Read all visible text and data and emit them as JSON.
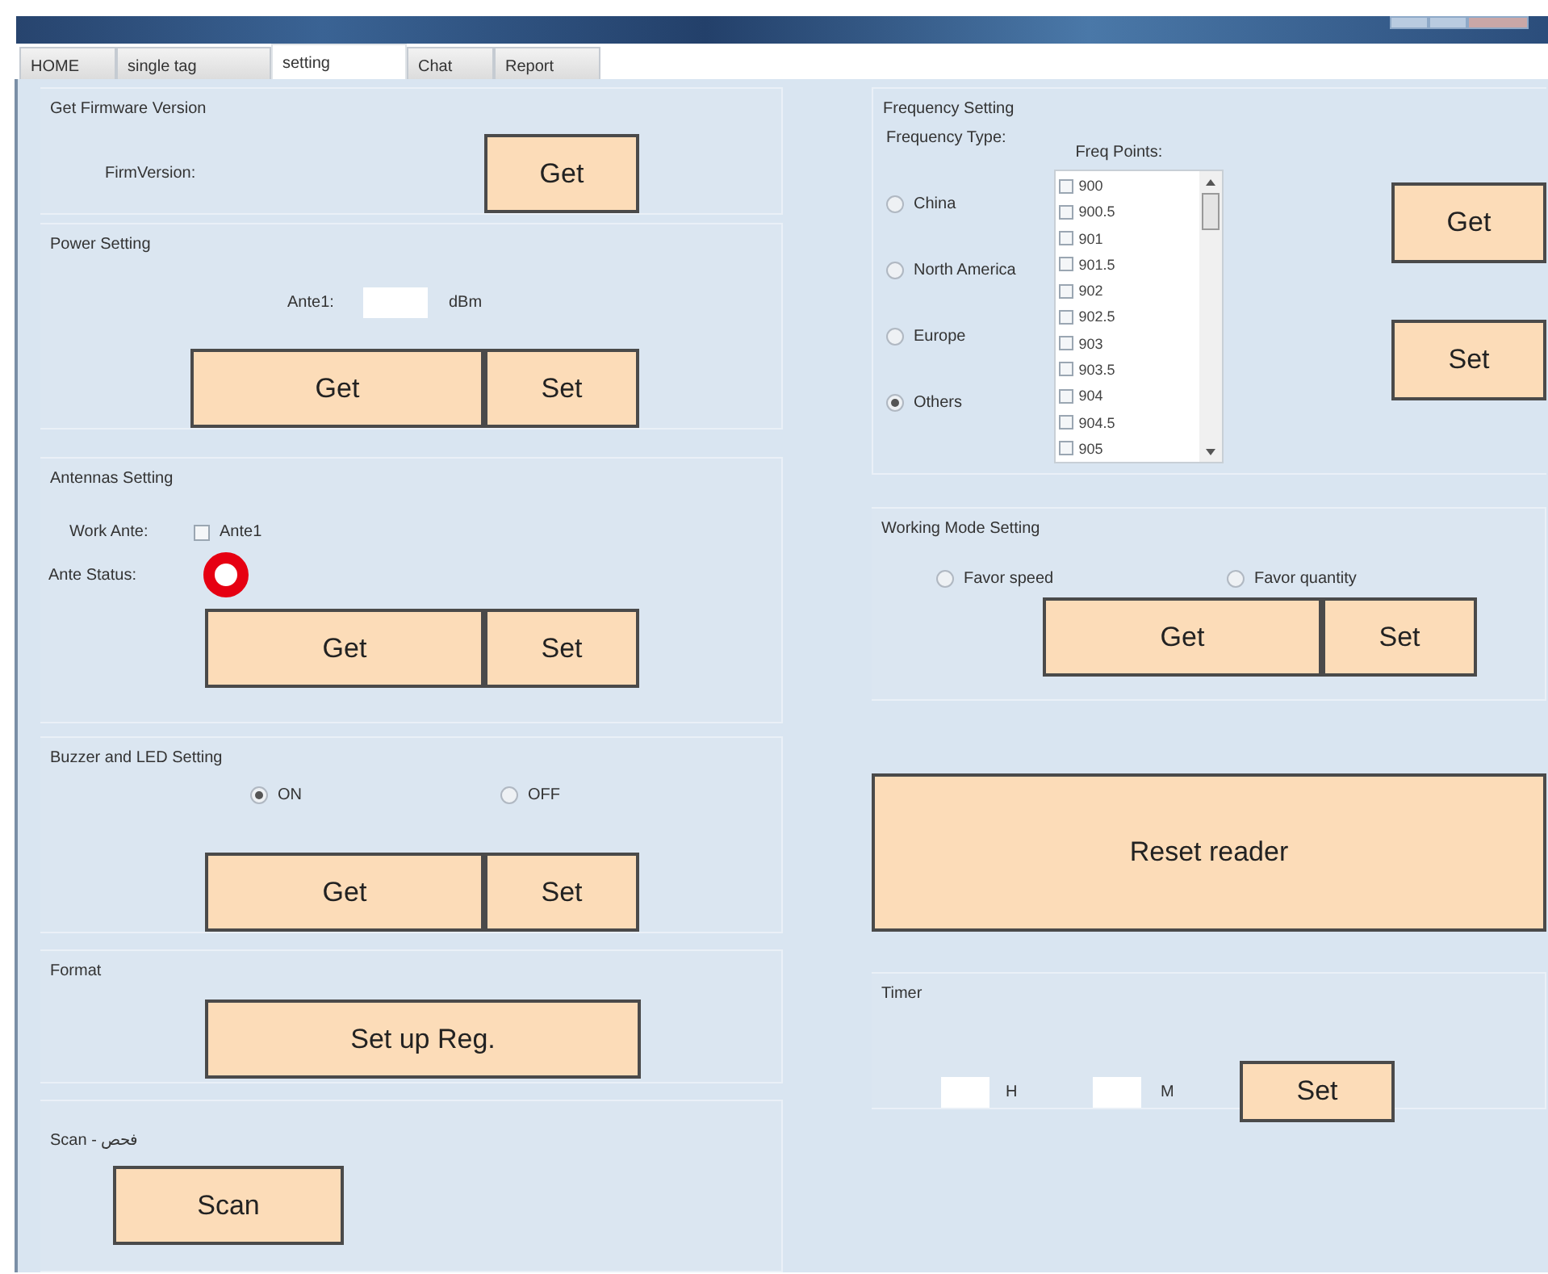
{
  "tabs": [
    {
      "label": "HOME",
      "selected": false
    },
    {
      "label": "single tag",
      "selected": false
    },
    {
      "label": "setting",
      "selected": true
    },
    {
      "label": "Chat",
      "selected": false
    },
    {
      "label": "Report",
      "selected": false
    }
  ],
  "left_column": [
    {
      "kind": "group",
      "title": "Get Firmware Version",
      "rows": [
        {
          "items": [
            {
              "kind": "label",
              "text": "FirmVersion:"
            },
            {
              "kind": "button",
              "text": "Get"
            }
          ]
        }
      ]
    },
    {
      "kind": "group",
      "title": "Power Setting",
      "rows": [
        {
          "items": [
            {
              "kind": "label",
              "text": "Ante1:"
            },
            {
              "kind": "input"
            },
            {
              "kind": "label",
              "text": "dBm"
            }
          ]
        },
        {
          "items": [
            {
              "kind": "button",
              "text": "Get"
            },
            {
              "kind": "button",
              "text": "Set"
            }
          ]
        }
      ]
    },
    {
      "kind": "group",
      "title": "Antennas  Setting",
      "rows": [
        {
          "items": [
            {
              "kind": "label",
              "text": "Work Ante:"
            },
            {
              "kind": "checkbox",
              "text": "Ante1",
              "checked": false
            }
          ]
        },
        {
          "items": [
            {
              "kind": "label",
              "text": "Ante Status:"
            },
            {
              "kind": "status",
              "color": "#e60012"
            }
          ]
        },
        {
          "items": [
            {
              "kind": "button",
              "text": "Get"
            },
            {
              "kind": "button",
              "text": "Set"
            }
          ]
        }
      ]
    },
    {
      "kind": "group",
      "title": "Buzzer and LED Setting",
      "rows": [
        {
          "items": [
            {
              "kind": "radio",
              "text": "ON",
              "selected": true
            },
            {
              "kind": "radio",
              "text": "OFF",
              "selected": false
            }
          ]
        },
        {
          "items": [
            {
              "kind": "button",
              "text": "Get"
            },
            {
              "kind": "button",
              "text": "Set"
            }
          ]
        }
      ]
    },
    {
      "kind": "group",
      "title": "Format",
      "rows": [
        {
          "items": [
            {
              "kind": "button",
              "text": "Set up Reg."
            }
          ]
        }
      ]
    },
    {
      "kind": "group",
      "title": "Scan - فحص",
      "rows": [
        {
          "items": [
            {
              "kind": "button",
              "text": "Scan"
            }
          ]
        }
      ]
    }
  ],
  "right_column": [
    {
      "kind": "frequency",
      "title": "Frequency Setting",
      "type_label": "Frequency Type:",
      "types": [
        {
          "label": "China",
          "selected": false
        },
        {
          "label": "North America",
          "selected": false
        },
        {
          "label": "Europe",
          "selected": false
        },
        {
          "label": "Others",
          "selected": true
        }
      ],
      "points_label": "Freq Points:",
      "points": [
        {
          "label": "900",
          "checked": false
        },
        {
          "label": "900.5",
          "checked": false
        },
        {
          "label": "901",
          "checked": false
        },
        {
          "label": "901.5",
          "checked": false
        },
        {
          "label": "902",
          "checked": false
        },
        {
          "label": "902.5",
          "checked": false
        },
        {
          "label": "903",
          "checked": false
        },
        {
          "label": "903.5",
          "checked": false
        },
        {
          "label": "904",
          "checked": false
        },
        {
          "label": "904.5",
          "checked": false
        },
        {
          "label": "905",
          "checked": false
        }
      ],
      "buttons": [
        "Get",
        "Set"
      ]
    },
    {
      "kind": "group",
      "title": "Working Mode Setting",
      "rows": [
        {
          "items": [
            {
              "kind": "radio",
              "text": "Favor speed",
              "selected": false
            },
            {
              "kind": "radio",
              "text": "Favor quantity",
              "selected": false
            }
          ]
        },
        {
          "items": [
            {
              "kind": "button",
              "text": "Get"
            },
            {
              "kind": "button",
              "text": "Set"
            }
          ]
        }
      ]
    },
    {
      "kind": "bare",
      "rows": [
        {
          "items": [
            {
              "kind": "button",
              "text": "Reset reader"
            }
          ]
        }
      ]
    },
    {
      "kind": "group",
      "title": "Timer",
      "rows": [
        {
          "items": [
            {
              "kind": "input"
            },
            {
              "kind": "label",
              "text": "H"
            },
            {
              "kind": "input"
            },
            {
              "kind": "label",
              "text": "M"
            },
            {
              "kind": "button",
              "text": "Set"
            }
          ]
        }
      ]
    }
  ]
}
